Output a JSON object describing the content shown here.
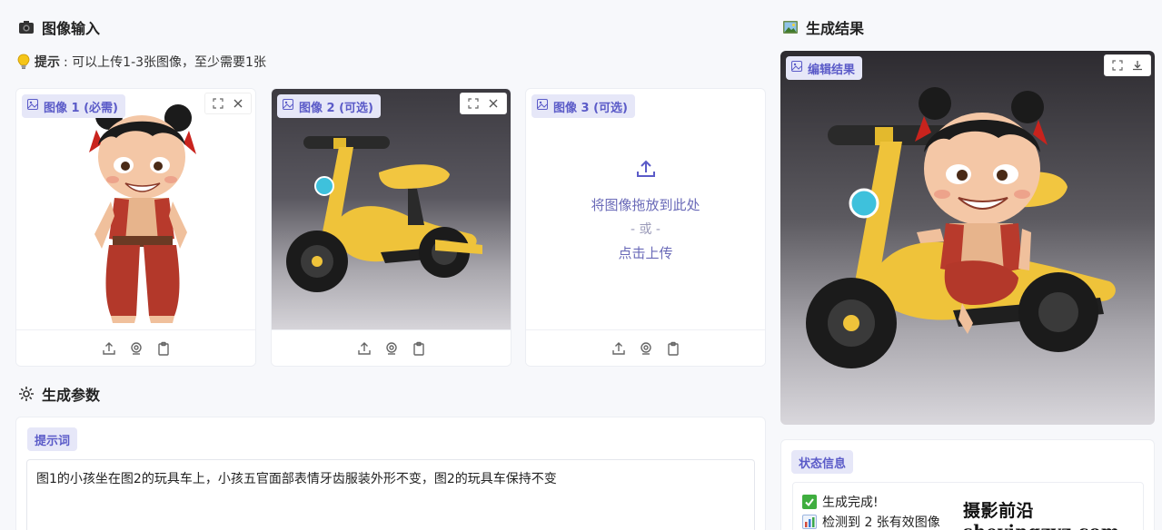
{
  "input_section": {
    "title": "图像输入",
    "icon": "camera-icon"
  },
  "hint": {
    "icon": "lightbulb-icon",
    "label": "提示",
    "text": ": 可以上传1-3张图像，至少需要1张"
  },
  "image_slots": [
    {
      "label": "图像 1 (必需)",
      "state": "filled",
      "content": "cartoon girl figure"
    },
    {
      "label": "图像 2 (可选)",
      "state": "filled",
      "content": "yellow balance bike"
    },
    {
      "label": "图像 3 (可选)",
      "state": "empty",
      "drop_text": "将图像拖放到此处",
      "or_text": "- 或 -",
      "click_text": "点击上传"
    }
  ],
  "params_section": {
    "title": "生成参数",
    "icon": "gear-icon"
  },
  "prompt": {
    "label": "提示词",
    "value": "图1的小孩坐在图2的玩具车上，小孩五官面部表情牙齿服装外形不变，图2的玩具车保持不变"
  },
  "result_section": {
    "title": "生成结果",
    "icon": "picture-icon"
  },
  "result": {
    "label": "编辑结果"
  },
  "status": {
    "label": "状态信息",
    "lines": [
      {
        "icon": "check-icon",
        "text": "生成完成!"
      },
      {
        "icon": "bar-chart-icon",
        "text": "检测到 2 张有效图像"
      }
    ]
  },
  "watermark": {
    "text": "摄影前沿 sheyingzyz.com"
  },
  "colors": {
    "accent": "#5b5bc8",
    "chip_bg": "#e6e7f8",
    "page_bg": "#f7f8fb"
  }
}
